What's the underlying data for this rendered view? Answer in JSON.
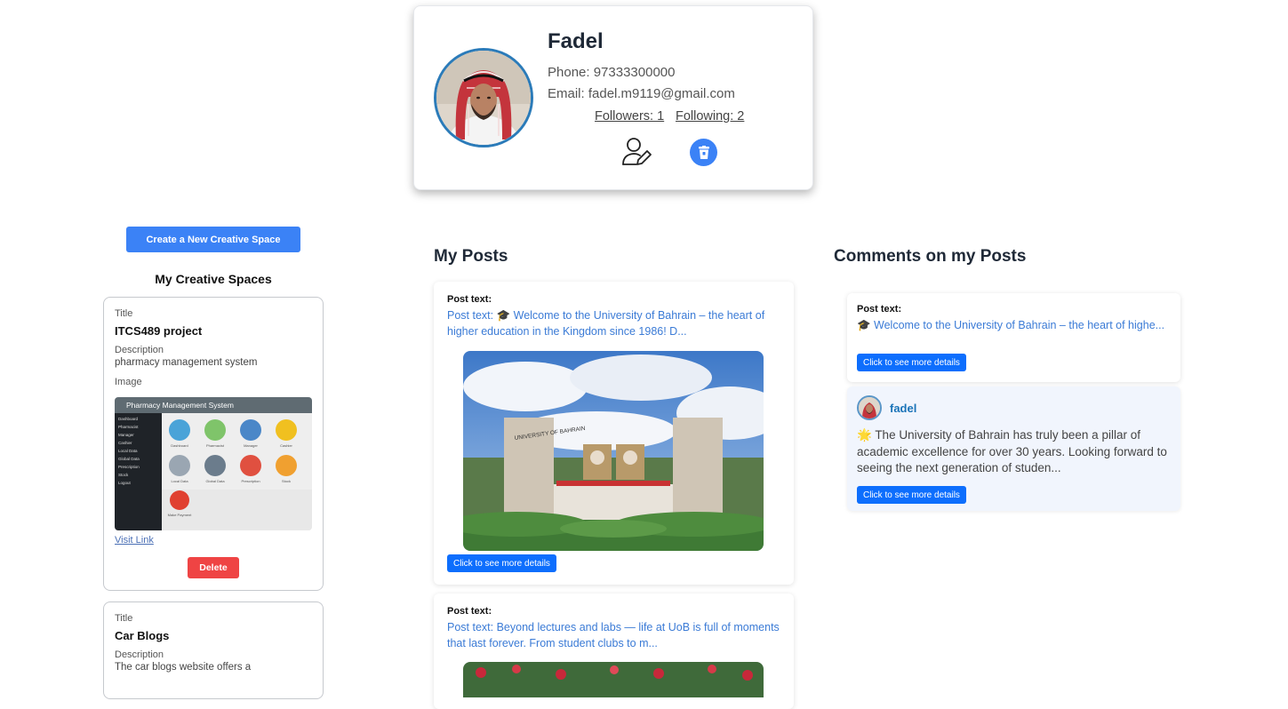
{
  "profile": {
    "name": "Fadel",
    "phone": "Phone: 97333300000",
    "email": "Email: fadel.m9119@gmail.com",
    "followers": "Followers: 1",
    "following": "Following: 2",
    "edit_icon": "user-edit-icon",
    "delete_icon": "trash-icon"
  },
  "creative_spaces": {
    "create_button": "Create a New Creative Space",
    "heading": "My Creative Spaces",
    "items": [
      {
        "title_label": "Title",
        "title": "ITCS489 project",
        "description_label": "Description",
        "description": "pharmacy management system",
        "image_label": "Image",
        "image_header": "Pharmacy Management System",
        "image_menu": [
          "Dashboard",
          "Pharmacist",
          "Manager",
          "Cashier",
          "Local Data",
          "Global Data",
          "Prescription",
          "Stock",
          "Logout"
        ],
        "image_tiles": [
          "Dashboard",
          "Pharmacist",
          "Manager",
          "Cashier",
          "Local Data",
          "Global Data",
          "Prescription",
          "Stock",
          "Make Payment"
        ],
        "visit_link": "Visit Link",
        "delete_button": "Delete"
      },
      {
        "title_label": "Title",
        "title": "Car Blogs",
        "description_label": "Description",
        "description": "The car blogs website offers a"
      }
    ]
  },
  "posts": {
    "heading": "My Posts",
    "items": [
      {
        "label": "Post text:",
        "text": "Post text: 🎓 Welcome to the University of Bahrain – the heart of higher education in the Kingdom since 1986! D...",
        "image_caption": "UNIVERSITY OF BAHRAIN",
        "details_button": "Click to see more details"
      },
      {
        "label": "Post text:",
        "text": "Post text: Beyond lectures and labs — life at UoB is full of moments that last forever. From student clubs to m..."
      }
    ]
  },
  "comments": {
    "heading": "Comments on my Posts",
    "post": {
      "label": "Post text:",
      "text": "🎓 Welcome to the University of Bahrain – the heart of highe...",
      "details_button": "Click to see more details"
    },
    "reply": {
      "user": "fadel",
      "text": "🌟 The University of Bahrain has truly been a pillar of academic excellence for over 30 years. Looking forward to seeing the next generation of studen...",
      "details_button": "Click to see more details"
    }
  },
  "colors": {
    "primary": "#3b82f6",
    "link": "#3b7bd6",
    "danger": "#ef4444",
    "avatar_ring": "#2b7bb9"
  }
}
